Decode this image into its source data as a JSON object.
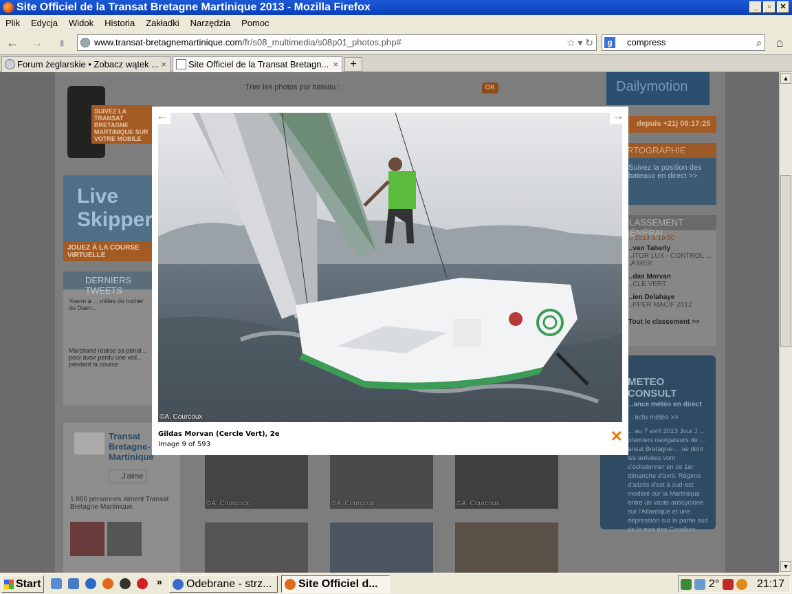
{
  "window": {
    "title": "Site Officiel de la Transat Bretagne Martinique 2013 - Mozilla Firefox"
  },
  "menu": [
    "Plik",
    "Edycja",
    "Widok",
    "Historia",
    "Zakładki",
    "Narzędzia",
    "Pomoc"
  ],
  "address": {
    "domain": "www.transat-bretagnemartinique.com",
    "path": "/fr/s08_multimedia/s08p01_photos.php#"
  },
  "search": {
    "engine": "google-icon",
    "value": "compress"
  },
  "tabs": [
    {
      "label": "Forum żeglarskie • Zobacz wątek ...",
      "active": false
    },
    {
      "label": "Site Officiel de la Transat Bretagn...",
      "active": true
    }
  ],
  "page": {
    "sort_label": "Trier les photos par bateau :",
    "ok_label": "OK",
    "promo_mobile": "SUIVEZ LA TRANSAT BRETAGNE MARTINIQUE SUR VOTRE MOBILE",
    "live_skipper": "Live Skipper",
    "live_skipper_cta": "JOUEZ À LA COURSE VIRTUELLE",
    "tweets_title": "DERNIERS TWEETS",
    "tweets": [
      "Yoann à ... milles du rocher du Diam...",
      "Marchand réalise sa pénal... pour avoir perdu une voil... pendant la course"
    ],
    "fb_title": "Transat Bretagne-Martinique",
    "fb_like": "J'aime",
    "fb_fans": "1 860 personnes aiment Transat Bretagne-Martinique.",
    "dailymotion": "Dailymotion",
    "timer": "depuis +21j 06:17:25",
    "carto_title": "CARTOGRAPHIE",
    "carto_text": "Suivez la position des bateaux en direct >>",
    "ranking_title": "CLASSEMENT GÉNÉRAL",
    "ranking_date": "... 2013 à 19:00",
    "ranking": [
      {
        "name": "...van Tabarly",
        "boat": "...ITOR LUX - CONTROL ... LA MER"
      },
      {
        "name": "...das Morvan",
        "boat": "...CLE VERT"
      },
      {
        "name": "...ien Delahaye",
        "boat": "...PPER MACIF 2012"
      }
    ],
    "ranking_more": "Tout le classement >>",
    "meteo_title": "METEO CONSULT",
    "meteo_sub": "...ance météo en direct",
    "meteo_link": "...'actu météo >>",
    "meteo_text": "... au 7 avril 2013 Jour J ... premiers navigateurs de ... ansat Bretagne-... ue dont les arrivées vont s'échelonner en ce 1er dimanche d'avril. Régime d'alizés d'est à sud-est modéré sur la Martinique entre un vaste anticyclone sur l'Atlantique et une dépression sur la partie sud de la mer des Caraïbes.",
    "thumb_credit": "©A. Courcoux"
  },
  "lightbox": {
    "caption": "Gildas Morvan (Cercle Vert), 2e",
    "counter": "Image 9 of 593",
    "credit": "©A. Courcoux",
    "prev_icon": "arrow-left-icon",
    "next_icon": "arrow-right-icon",
    "close_icon": "close-icon",
    "accent": "#d47a1c"
  },
  "taskbar": {
    "start": "Start",
    "items": [
      {
        "label": "Odebrane - strz...",
        "active": false
      },
      {
        "label": "Site Officiel d...",
        "active": true
      }
    ],
    "temperature": "2°",
    "clock": "21:17"
  }
}
